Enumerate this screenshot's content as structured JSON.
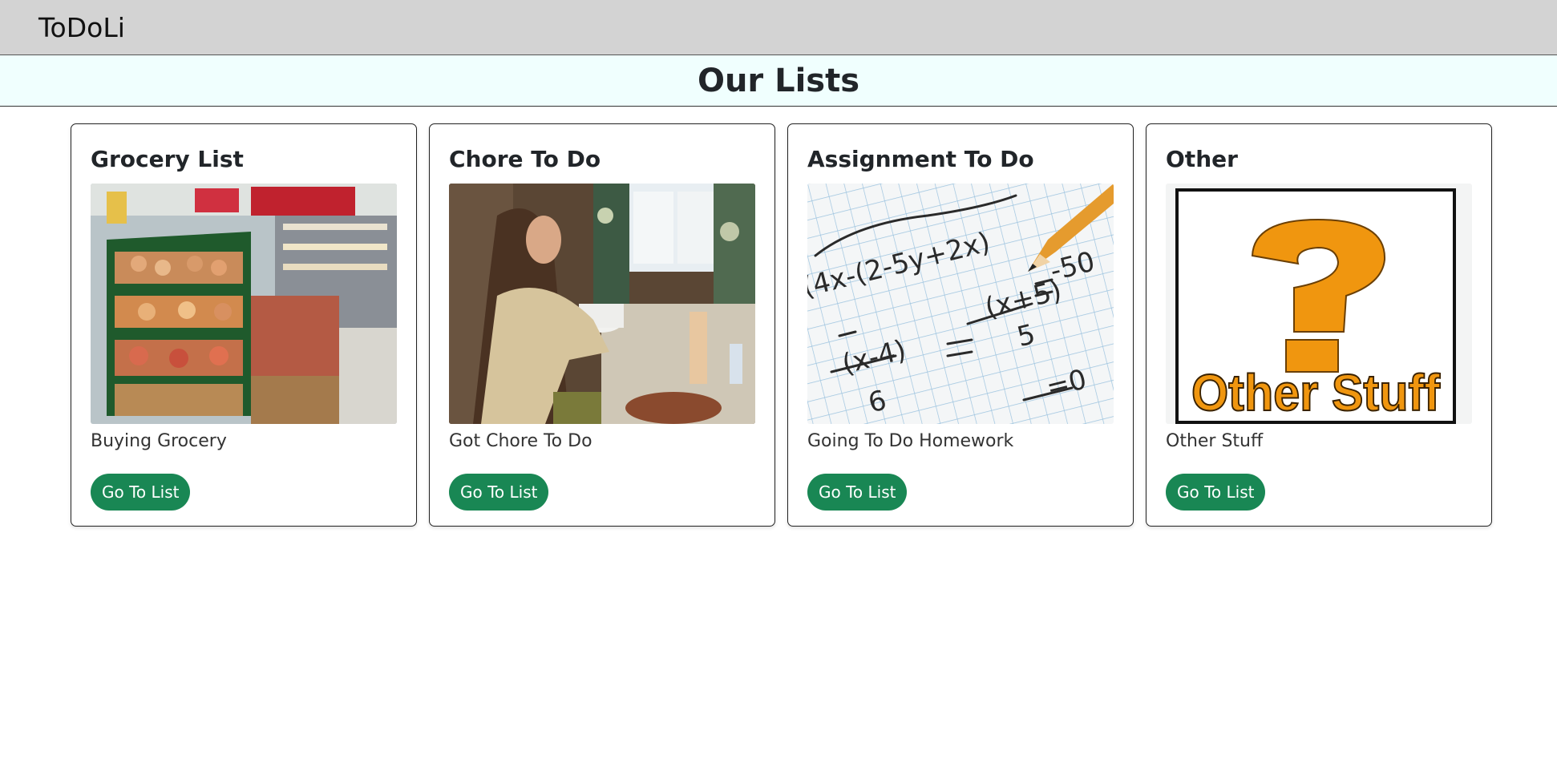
{
  "navbar": {
    "brand": "ToDoLi"
  },
  "header": {
    "title": "Our Lists"
  },
  "colors": {
    "button": "#198754",
    "navbar": "#d3d3d3",
    "header_bg": "#f0fffe"
  },
  "cards": [
    {
      "title": "Grocery List",
      "image": "grocery-store-photo",
      "text": "Buying Grocery",
      "button": "Go To List"
    },
    {
      "title": "Chore To Do",
      "image": "woman-washing-dishes-photo",
      "text": "Got Chore To Do",
      "button": "Go To List"
    },
    {
      "title": "Assignment To Do",
      "image": "math-homework-pencil-photo",
      "text": "Going To Do Homework",
      "button": "Go To List"
    },
    {
      "title": "Other",
      "image": "question-mark-other-stuff-graphic",
      "image_caption": "Other Stuff",
      "text": "Other Stuff",
      "button": "Go To List"
    }
  ]
}
